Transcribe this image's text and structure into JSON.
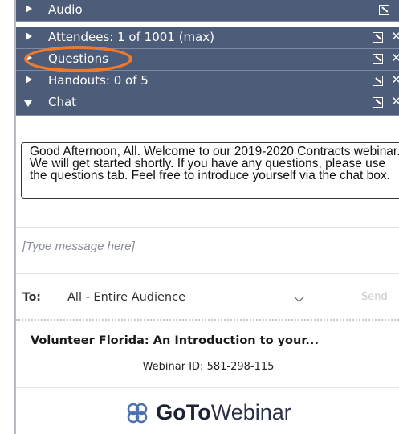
{
  "panels": {
    "audio": {
      "label": "Audio"
    },
    "attendees": {
      "label": "Attendees: 1 of 1001 (max)"
    },
    "questions": {
      "label": "Questions"
    },
    "handouts": {
      "label": "Handouts: 0 of 5"
    },
    "chat": {
      "label": "Chat"
    }
  },
  "chat": {
    "message": "Good Afternoon, All. Welcome to our 2019-2020 Contracts webinar. We will get started shortly. If you have any questions, please use the questions tab. Feel free to introduce yourself via the chat box.",
    "input_placeholder": "[Type message here]",
    "to_label": "To:",
    "to_value": "All - Entire Audience",
    "send_label": "Send"
  },
  "footer": {
    "webinar_title": "Volunteer Florida: An Introduction to your...",
    "webinar_id": "Webinar ID: 581-298-115",
    "logo_goto": "GoTo",
    "logo_webinar": "Webinar"
  },
  "icons": {
    "panel_expand": "triangle-right-icon",
    "panel_collapse": "triangle-down-icon",
    "popout": "popout-icon",
    "close": "close-icon",
    "dropdown": "chevron-down-icon",
    "logo": "gotowebinar-logo-icon"
  },
  "colors": {
    "panel_header": "#4d5c78",
    "highlight_ring": "#f07a2c",
    "logo_text": "#1e2235"
  }
}
